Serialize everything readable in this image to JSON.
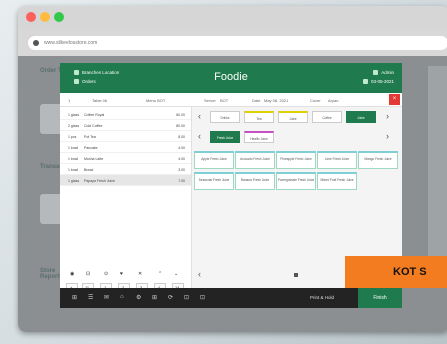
{
  "browser": {
    "url": "www.silkeeloustore.com"
  },
  "background": {
    "label_1": "Order Type",
    "label_2": "Transaction",
    "label_3": "Store Reports",
    "tile_1": "",
    "tile_2": "KOT"
  },
  "pos": {
    "brand": "Foodie",
    "header_left_1": "Branches Location",
    "header_left_2": "Orders",
    "header_right_1": "Admin",
    "header_right_2": "03-05-2021",
    "toprow": {
      "field_1": "1",
      "field_2": "Table 06",
      "field_3": "Menu BOT",
      "field_4": "Server",
      "field_5": "BOT",
      "field_6": "Date",
      "field_7": "May 08, 2021",
      "field_8": "Cover",
      "field_9": "Aryan"
    },
    "close_label": "×",
    "orders": [
      {
        "qty": "1 glass",
        "name": "Coffee Royal",
        "price": "60.00"
      },
      {
        "qty": "2 glass",
        "name": "Cold Coffee",
        "price": "80.00"
      },
      {
        "qty": "1 pcs",
        "name": "Pot Tea",
        "price": "8.00"
      },
      {
        "qty": "1 bowl",
        "name": "Pancake",
        "price": "4.00"
      },
      {
        "qty": "1 bowl",
        "name": "Mocha Latte",
        "price": "4.00"
      },
      {
        "qty": "1 bowl",
        "name": "Bread",
        "price": "3.00"
      },
      {
        "qty": "1 glass",
        "name": "Papaya Fresh Juice",
        "price": "7.00"
      }
    ],
    "keypad_row_1": [
      "◉",
      "⊡",
      "⊙",
      "♥",
      "✕",
      "⌃",
      "⌄"
    ],
    "keypad_row_2": [
      "+",
      "11",
      "1",
      "2",
      "3",
      "4",
      "14"
    ],
    "categories": [
      "Drinks",
      "Tea",
      "Juice",
      "Coffee",
      "Juice"
    ],
    "subcats": [
      "Fresh Juice",
      "Health Juice"
    ],
    "items": [
      "Apple Fresh Juice",
      "Avocado Fresh Juice",
      "Pineapple Fresh Juice",
      "Lime Fresh Juice",
      "Mango Fresh Juice",
      "Seasonal Fresh Juice",
      "Banana Fresh Juice",
      "Pomegranate Fresh Juice",
      "Mixed Fruit Fresh Juice"
    ],
    "bottom_icons": [
      "⊞",
      "☰",
      "✉",
      "⌂",
      "⚙",
      "⊞",
      "⟳",
      "⊡",
      "⊡"
    ],
    "send_hold": "Print & Hold",
    "finish": "Finish"
  },
  "badge": {
    "text": "KOT S"
  }
}
